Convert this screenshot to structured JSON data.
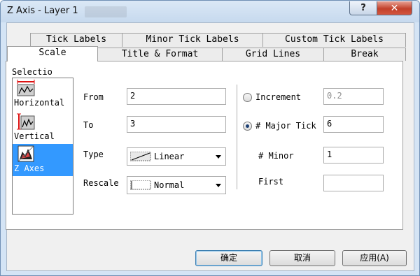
{
  "window": {
    "title": "Z Axis - Layer 1",
    "help_label": "?",
    "close_label": "✕"
  },
  "tabs_top": [
    {
      "label": "Tick Labels"
    },
    {
      "label": "Minor Tick Labels"
    },
    {
      "label": "Custom Tick Labels"
    }
  ],
  "tabs_bottom": [
    {
      "label": "Scale",
      "active": true
    },
    {
      "label": "Title & Format"
    },
    {
      "label": "Grid Lines"
    },
    {
      "label": "Break"
    }
  ],
  "selection": {
    "label": "Selectio",
    "items": [
      {
        "label": "Horizontal",
        "icon": "horizontal-axis-icon"
      },
      {
        "label": "Vertical",
        "icon": "vertical-axis-icon"
      },
      {
        "label": "Z Axes",
        "icon": "z-axis-icon",
        "selected": true
      }
    ]
  },
  "scale": {
    "from_label": "From",
    "from_value": "2",
    "to_label": "To",
    "to_value": "3",
    "type_label": "Type",
    "type_value": "Linear",
    "rescale_label": "Rescale",
    "rescale_value": "Normal"
  },
  "ticks": {
    "increment_label": "Increment",
    "increment_value": "0.2",
    "increment_selected": false,
    "major_label": "# Major Tick",
    "major_value": "6",
    "major_selected": true,
    "minor_label": "# Minor",
    "minor_value": "1",
    "first_label": "First",
    "first_value": ""
  },
  "buttons": {
    "ok": "确定",
    "cancel": "取消",
    "apply": "应用(A)"
  },
  "colors": {
    "selection_highlight": "#3399ff",
    "titlebar": "#c6d9ee",
    "close": "#c2402a"
  }
}
